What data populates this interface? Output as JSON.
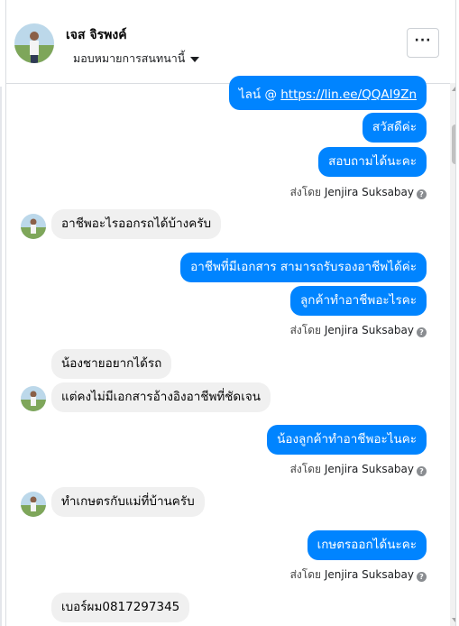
{
  "header": {
    "name": "เจส จิรพงค์",
    "assign_label": "มอบหมายการสนทนานี้",
    "more_label": "···"
  },
  "messages": [
    {
      "dir": "out",
      "text_prefix": "ไลน์ @  ",
      "link": "https://lin.ee/QQAI9Zn"
    },
    {
      "dir": "out",
      "text": "สวัสดีค่ะ"
    },
    {
      "dir": "out",
      "text": "สอบถามได้นะคะ"
    },
    {
      "dir": "meta",
      "prefix": "ส่งโดย",
      "name": "Jenjira Suksabay"
    },
    {
      "dir": "in",
      "text": "อาชีพอะไรออกรถได้บ้างครับ"
    },
    {
      "dir": "out",
      "text": "อาชีพที่มีเอกสาร สามารถรับรองอาชีพได้ค่ะ"
    },
    {
      "dir": "out",
      "text": "ลูกค้าทำอาชีพอะไรคะ"
    },
    {
      "dir": "meta",
      "prefix": "ส่งโดย",
      "name": "Jenjira Suksabay"
    },
    {
      "dir": "in",
      "text": "น้องชายอยากได้รถ"
    },
    {
      "dir": "in",
      "text": "แต่คงไม่มีเอกสารอ้างอิงอาชีพที่ชัดเจน"
    },
    {
      "dir": "out",
      "text": "น้องลูกค้าทำอาชีพอะไนคะ"
    },
    {
      "dir": "meta",
      "prefix": "ส่งโดย",
      "name": "Jenjira Suksabay"
    },
    {
      "dir": "in",
      "text": "ทำเกษตรกับแม่ที่บ้านครับ"
    },
    {
      "dir": "out",
      "text": "เกษตรออกได้นะคะ"
    },
    {
      "dir": "meta",
      "prefix": "ส่งโดย",
      "name": "Jenjira Suksabay"
    },
    {
      "dir": "in",
      "text": "เบอร์ผม0817297345"
    }
  ],
  "colors": {
    "accent": "#0084ff",
    "incoming": "#f0f0f0"
  }
}
